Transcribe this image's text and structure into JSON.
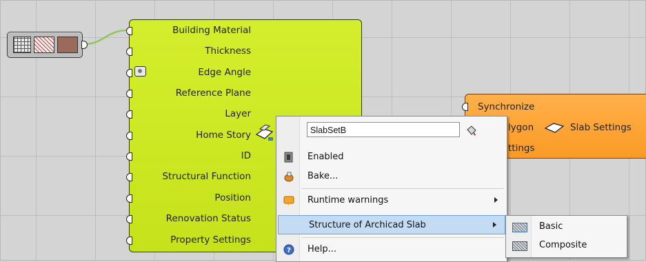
{
  "main_node": {
    "params": [
      "Building Material",
      "Thickness",
      "Edge Angle",
      "Reference Plane",
      "Layer",
      "Home Story",
      "ID",
      "Structural Function",
      "Position",
      "Renovation Status",
      "Property Settings"
    ]
  },
  "orange_node": {
    "synchronize": "Synchronize",
    "polygon": "lygon",
    "slab_settings": "Slab Settings",
    "settings": "ttings"
  },
  "context_menu": {
    "name_value": "SlabSetB",
    "enabled": "Enabled",
    "bake": "Bake...",
    "runtime_warnings": "Runtime warnings",
    "structure": "Structure of Archicad Slab",
    "help": "Help..."
  },
  "submenu": {
    "basic": "Basic",
    "composite": "Composite"
  },
  "colors": {
    "node_green": "#c6e21b",
    "node_orange": "#fb9a26",
    "highlight": "#c4dcf3",
    "wire": "#8fc75a"
  }
}
